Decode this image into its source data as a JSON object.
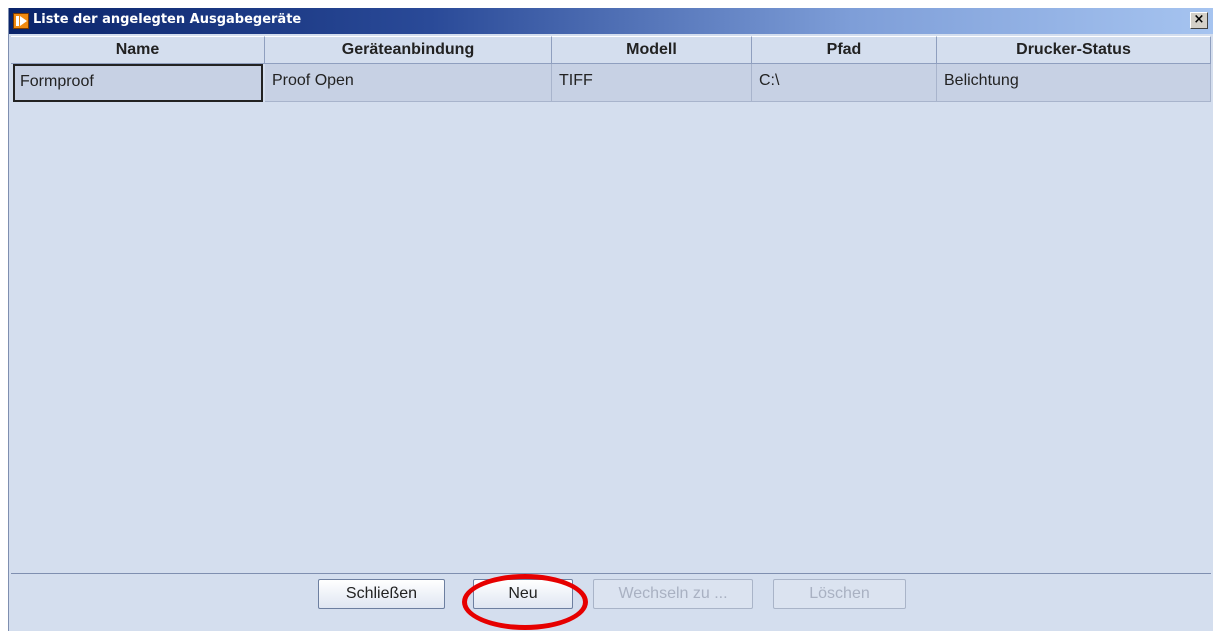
{
  "window": {
    "title": "Liste der angelegten Ausgabegeräte",
    "close_label": "×",
    "app_icon": "app-logo-icon"
  },
  "table": {
    "columns": [
      "Name",
      "Geräteanbindung",
      "Modell",
      "Pfad",
      "Drucker-Status"
    ],
    "rows": [
      [
        "Formproof",
        "Proof Open",
        "TIFF",
        "C:\\",
        "Belichtung"
      ]
    ]
  },
  "buttons": {
    "close": "Schließen",
    "new": "Neu",
    "switch": "Wechseln zu ...",
    "delete": "Löschen"
  },
  "annotation": {
    "highlight_color": "#e60000",
    "highlighted_button": "new"
  }
}
